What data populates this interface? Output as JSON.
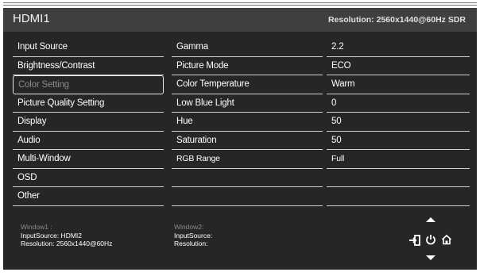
{
  "header": {
    "title": "HDMI1",
    "resolution": "Resolution: 2560x1440@60Hz SDR"
  },
  "menu": [
    {
      "label": "Input Source"
    },
    {
      "label": "Brightness/Contrast"
    },
    {
      "label": "Color Setting",
      "selected": true
    },
    {
      "label": "Picture Quality Setting"
    },
    {
      "label": "Display"
    },
    {
      "label": "Audio"
    },
    {
      "label": "Multi-Window"
    },
    {
      "label": "OSD"
    },
    {
      "label": "Other"
    }
  ],
  "submenu": [
    {
      "label": "Gamma",
      "value": "2.2"
    },
    {
      "label": "Picture Mode",
      "value": "ECO"
    },
    {
      "label": "Color Temperature",
      "value": "Warm"
    },
    {
      "label": "Low Blue Light",
      "value": "0"
    },
    {
      "label": "Hue",
      "value": "50"
    },
    {
      "label": "Saturation",
      "value": "50"
    },
    {
      "label": "RGB Range",
      "value": "Full"
    },
    {
      "label": "",
      "value": ""
    },
    {
      "label": "",
      "value": ""
    }
  ],
  "window1": {
    "title": "Window1 :",
    "input_source": "InputSource: HDMI2",
    "resolution": "Resolution: 2560x1440@60Hz"
  },
  "window2": {
    "title": "Window2:",
    "input_source": "InputSource:",
    "resolution": "Resolution:"
  },
  "controls": {
    "up": "triangle-up-icon",
    "down": "triangle-down-icon",
    "input": "input-source-icon",
    "power": "power-icon",
    "home": "home-icon"
  },
  "colors": {
    "background": "#262626",
    "header": "#3f3f3f",
    "text": "#ffffff",
    "dim_text": "#8a8a8a",
    "row_line": "#cfcfcf"
  }
}
